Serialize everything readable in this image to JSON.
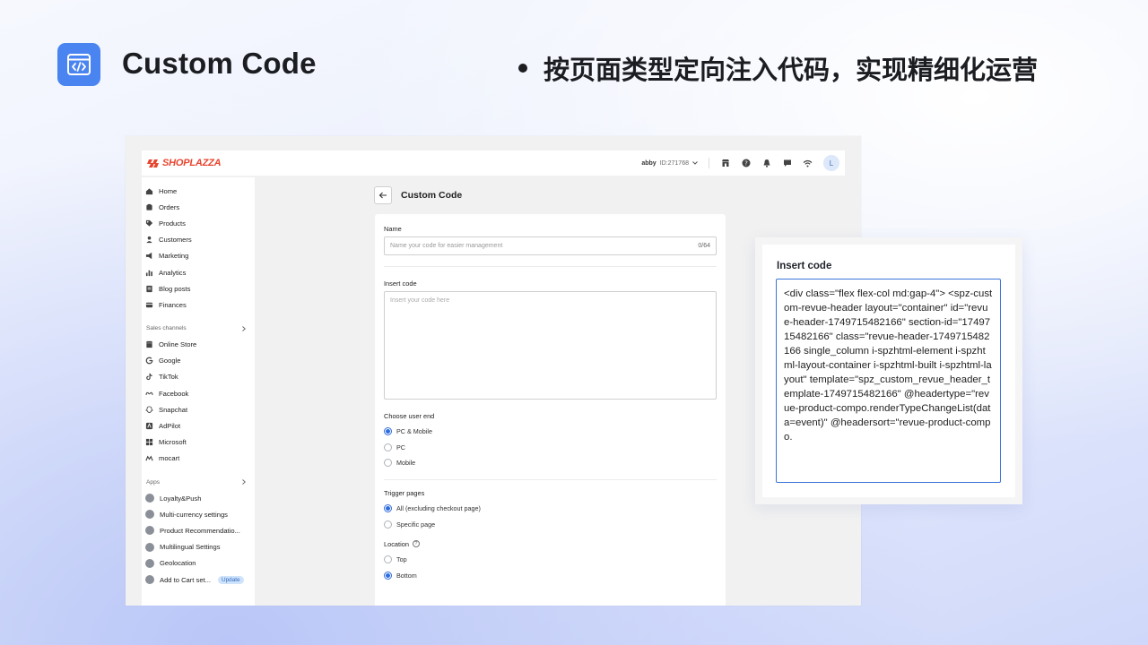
{
  "hero": {
    "title": "Custom Code",
    "bullet": "按页面类型定向注入代码，实现精细化运营",
    "accent": "#4a84f0"
  },
  "topbar": {
    "logo": "SHOPLAZZA",
    "account_name": "abby",
    "account_id": "ID:271768",
    "avatar": "L"
  },
  "sidebar": {
    "items": [
      {
        "label": "Home",
        "icon": "home-icon"
      },
      {
        "label": "Orders",
        "icon": "orders-icon"
      },
      {
        "label": "Products",
        "icon": "tag-icon"
      },
      {
        "label": "Customers",
        "icon": "user-icon"
      },
      {
        "label": "Marketing",
        "icon": "megaphone-icon"
      },
      {
        "label": "Analytics",
        "icon": "bar-chart-icon"
      },
      {
        "label": "Blog posts",
        "icon": "blog-icon"
      },
      {
        "label": "Finances",
        "icon": "finance-icon"
      }
    ],
    "sales_channels_label": "Sales channels",
    "channels": [
      {
        "label": "Online Store",
        "icon": "store-icon"
      },
      {
        "label": "Google",
        "icon": "google-icon"
      },
      {
        "label": "TikTok",
        "icon": "tiktok-icon"
      },
      {
        "label": "Facebook",
        "icon": "meta-icon"
      },
      {
        "label": "Snapchat",
        "icon": "snapchat-icon"
      },
      {
        "label": "AdPilot",
        "icon": "adpilot-icon"
      },
      {
        "label": "Microsoft",
        "icon": "microsoft-icon"
      },
      {
        "label": "mocart",
        "icon": "mocart-icon"
      }
    ],
    "apps_label": "Apps",
    "apps": [
      {
        "label": "Loyalty&Push"
      },
      {
        "label": "Multi-currency settings"
      },
      {
        "label": "Product Recommendatio..."
      },
      {
        "label": "Multilingual Settings"
      },
      {
        "label": "Geolocation"
      },
      {
        "label": "Add to Cart set...",
        "badge": "Update"
      }
    ]
  },
  "page": {
    "title": "Custom Code",
    "name_label": "Name",
    "name_placeholder": "Name your code for easier management",
    "name_count": "0/64",
    "insert_label": "Insert code",
    "insert_placeholder": "Insert your code here",
    "user_end_label": "Choose user end",
    "user_end_options": [
      {
        "label": "PC & Mobile",
        "selected": true
      },
      {
        "label": "PC",
        "selected": false
      },
      {
        "label": "Mobile",
        "selected": false
      }
    ],
    "trigger_label": "Trigger pages",
    "trigger_options": [
      {
        "label": "All (excluding checkout page)",
        "selected": true
      },
      {
        "label": "Specific page",
        "selected": false
      }
    ],
    "location_label": "Location",
    "location_options": [
      {
        "label": "Top",
        "selected": false
      },
      {
        "label": "Bottom",
        "selected": true
      }
    ]
  },
  "zoom": {
    "label": "Insert code",
    "code": "<div class=\"flex flex-col md:gap-4\"> <spz-custom-revue-header layout=\"container\" id=\"revue-header-1749715482166\" section-id=\"1749715482166\" class=\"revue-header-1749715482166 single_column i-spzhtml-element i-spzhtml-layout-container i-spzhtml-built i-spzhtml-layout\" template=\"spz_custom_revue_header_template-1749715482166\" @headertype=\"revue-product-compo.renderTypeChangeList(data=event)\" @headersort=\"revue-product-compo."
  }
}
